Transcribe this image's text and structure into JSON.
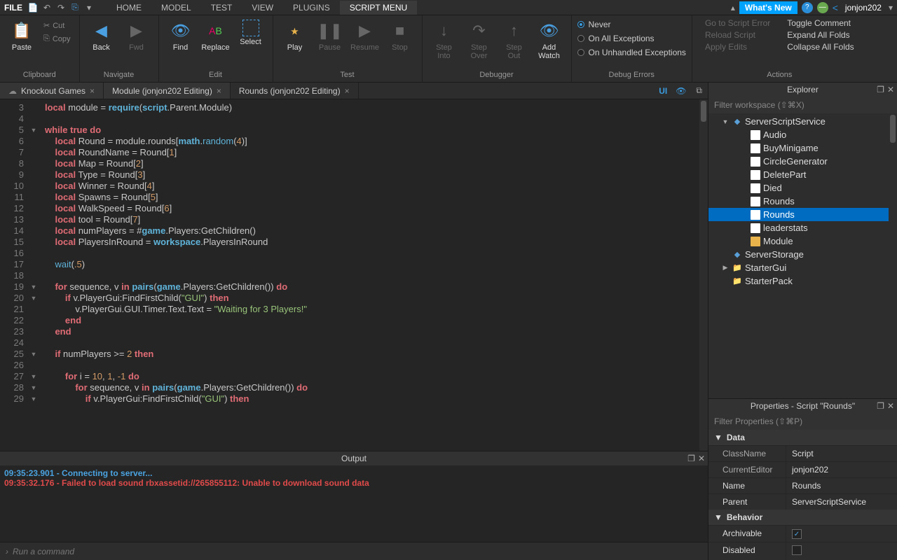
{
  "menu": {
    "file": "FILE",
    "tabs": [
      "HOME",
      "MODEL",
      "TEST",
      "VIEW",
      "PLUGINS",
      "SCRIPT MENU"
    ],
    "activeTab": 5,
    "whatsnew": "What's New",
    "username": "jonjon202"
  },
  "ribbon": {
    "clipboard": {
      "paste": "Paste",
      "cut": "Cut",
      "copy": "Copy",
      "label": "Clipboard"
    },
    "navigate": {
      "back": "Back",
      "fwd": "Fwd",
      "label": "Navigate"
    },
    "edit": {
      "find": "Find",
      "replace": "Replace",
      "select": "Select",
      "label": "Edit"
    },
    "test": {
      "play": "Play",
      "pause": "Pause",
      "resume": "Resume",
      "stop": "Stop",
      "label": "Test"
    },
    "debugger": {
      "stepinto": "Step\nInto",
      "stepover": "Step\nOver",
      "stepout": "Step\nOut",
      "addwatch": "Add\nWatch",
      "label": "Debugger"
    },
    "debugerrors": {
      "never": "Never",
      "onall": "On All Exceptions",
      "onunhand": "On Unhandled Exceptions",
      "label": "Debug Errors"
    },
    "actions1": {
      "goto": "Go to Script Error",
      "reload": "Reload Script",
      "apply": "Apply Edits"
    },
    "actions2": {
      "toggle": "Toggle Comment",
      "expand": "Expand All Folds",
      "collapse": "Collapse All Folds",
      "label": "Actions"
    }
  },
  "doctabs": {
    "items": [
      {
        "label": "Knockout Games",
        "hasCloud": true
      },
      {
        "label": "Module (jonjon202 Editing)"
      },
      {
        "label": "Rounds (jonjon202 Editing)"
      }
    ],
    "active": 2,
    "ui": "UI"
  },
  "code": {
    "startLine": 3,
    "lines": [
      [
        [
          "kw",
          "local"
        ],
        [
          "id",
          " module "
        ],
        [
          "op",
          "= "
        ],
        [
          "glob",
          "require"
        ],
        [
          "op",
          "("
        ],
        [
          "glob",
          "script"
        ],
        [
          "op",
          ".Parent.Module)"
        ]
      ],
      [],
      [
        [
          "kw",
          "while true do"
        ]
      ],
      [
        [
          "id",
          "    "
        ],
        [
          "kw",
          "local"
        ],
        [
          "id",
          " Round = module.rounds["
        ],
        [
          "glob",
          "math"
        ],
        [
          "op",
          "."
        ],
        [
          "fn",
          "random"
        ],
        [
          "op",
          "("
        ],
        [
          "num",
          "4"
        ],
        [
          "op",
          ")]"
        ]
      ],
      [
        [
          "id",
          "    "
        ],
        [
          "kw",
          "local"
        ],
        [
          "id",
          " RoundName = Round["
        ],
        [
          "num",
          "1"
        ],
        [
          "op",
          "]"
        ]
      ],
      [
        [
          "id",
          "    "
        ],
        [
          "kw",
          "local"
        ],
        [
          "id",
          " Map = Round["
        ],
        [
          "num",
          "2"
        ],
        [
          "op",
          "]"
        ]
      ],
      [
        [
          "id",
          "    "
        ],
        [
          "kw",
          "local"
        ],
        [
          "id",
          " Type = Round["
        ],
        [
          "num",
          "3"
        ],
        [
          "op",
          "]"
        ]
      ],
      [
        [
          "id",
          "    "
        ],
        [
          "kw",
          "local"
        ],
        [
          "id",
          " Winner = Round["
        ],
        [
          "num",
          "4"
        ],
        [
          "op",
          "]"
        ]
      ],
      [
        [
          "id",
          "    "
        ],
        [
          "kw",
          "local"
        ],
        [
          "id",
          " Spawns = Round["
        ],
        [
          "num",
          "5"
        ],
        [
          "op",
          "]"
        ]
      ],
      [
        [
          "id",
          "    "
        ],
        [
          "kw",
          "local"
        ],
        [
          "id",
          " WalkSpeed = Round["
        ],
        [
          "num",
          "6"
        ],
        [
          "op",
          "]"
        ]
      ],
      [
        [
          "id",
          "    "
        ],
        [
          "kw",
          "local"
        ],
        [
          "id",
          " tool = Round["
        ],
        [
          "num",
          "7"
        ],
        [
          "op",
          "]"
        ]
      ],
      [
        [
          "id",
          "    "
        ],
        [
          "kw",
          "local"
        ],
        [
          "id",
          " numPlayers = #"
        ],
        [
          "glob",
          "game"
        ],
        [
          "op",
          ".Players:GetChildren()"
        ]
      ],
      [
        [
          "id",
          "    "
        ],
        [
          "kw",
          "local"
        ],
        [
          "id",
          " PlayersInRound = "
        ],
        [
          "glob",
          "workspace"
        ],
        [
          "op",
          ".PlayersInRound"
        ]
      ],
      [],
      [
        [
          "id",
          "    "
        ],
        [
          "fn",
          "wait"
        ],
        [
          "op",
          "("
        ],
        [
          "num",
          ".5"
        ],
        [
          "op",
          ")"
        ]
      ],
      [],
      [
        [
          "id",
          "    "
        ],
        [
          "kw",
          "for"
        ],
        [
          "id",
          " sequence, v "
        ],
        [
          "kw",
          "in"
        ],
        [
          "id",
          " "
        ],
        [
          "glob",
          "pairs"
        ],
        [
          "op",
          "("
        ],
        [
          "glob",
          "game"
        ],
        [
          "op",
          ".Players:GetChildren()) "
        ],
        [
          "kw",
          "do"
        ]
      ],
      [
        [
          "id",
          "        "
        ],
        [
          "kw",
          "if"
        ],
        [
          "id",
          " v.PlayerGui:FindFirstChild("
        ],
        [
          "str",
          "\"GUI\""
        ],
        [
          "op",
          ") "
        ],
        [
          "kw",
          "then"
        ]
      ],
      [
        [
          "id",
          "            v.PlayerGui.GUI.Timer.Text.Text = "
        ],
        [
          "str",
          "\"Waiting for 3 Players!\""
        ]
      ],
      [
        [
          "id",
          "        "
        ],
        [
          "kw",
          "end"
        ]
      ],
      [
        [
          "id",
          "    "
        ],
        [
          "kw",
          "end"
        ]
      ],
      [],
      [
        [
          "id",
          "    "
        ],
        [
          "kw",
          "if"
        ],
        [
          "id",
          " numPlayers >= "
        ],
        [
          "num",
          "2"
        ],
        [
          "id",
          " "
        ],
        [
          "kw",
          "then"
        ]
      ],
      [],
      [
        [
          "id",
          "        "
        ],
        [
          "kw",
          "for"
        ],
        [
          "id",
          " i = "
        ],
        [
          "num",
          "10"
        ],
        [
          "op",
          ", "
        ],
        [
          "num",
          "1"
        ],
        [
          "op",
          ", "
        ],
        [
          "num",
          "-1"
        ],
        [
          "id",
          " "
        ],
        [
          "kw",
          "do"
        ]
      ],
      [
        [
          "id",
          "            "
        ],
        [
          "kw",
          "for"
        ],
        [
          "id",
          " sequence, v "
        ],
        [
          "kw",
          "in"
        ],
        [
          "id",
          " "
        ],
        [
          "glob",
          "pairs"
        ],
        [
          "op",
          "("
        ],
        [
          "glob",
          "game"
        ],
        [
          "op",
          ".Players:GetChildren()) "
        ],
        [
          "kw",
          "do"
        ]
      ],
      [
        [
          "id",
          "                "
        ],
        [
          "kw",
          "if"
        ],
        [
          "id",
          " v.PlayerGui:FindFirstChild("
        ],
        [
          "str",
          "\"GUI\""
        ],
        [
          "op",
          ") "
        ],
        [
          "kw",
          "then"
        ]
      ]
    ],
    "foldMarks": {
      "5": "▼",
      "19": "▼",
      "20": "▼",
      "25": "▼",
      "27": "▼",
      "28": "▼",
      "29": "▼"
    }
  },
  "output": {
    "title": "Output",
    "lines": [
      {
        "cls": "l1",
        "text": "09:35:23.901 - Connecting to server..."
      },
      {
        "cls": "l2",
        "text": "09:35:32.176 - Failed to load sound rbxassetid://265855112: Unable to download sound data"
      }
    ]
  },
  "cmd": {
    "placeholder": "Run a command"
  },
  "explorer": {
    "title": "Explorer",
    "filter": "Filter workspace (⇧⌘X)",
    "tree": [
      {
        "d": 1,
        "arr": "▼",
        "ico": "service",
        "label": "ServerScriptService"
      },
      {
        "d": 2,
        "ico": "script",
        "label": "Audio"
      },
      {
        "d": 2,
        "ico": "script",
        "label": "BuyMinigame"
      },
      {
        "d": 2,
        "ico": "script",
        "label": "CircleGenerator"
      },
      {
        "d": 2,
        "ico": "script",
        "label": "DeletePart"
      },
      {
        "d": 2,
        "ico": "script",
        "label": "Died"
      },
      {
        "d": 2,
        "ico": "script",
        "label": "Rounds"
      },
      {
        "d": 2,
        "ico": "script",
        "label": "Rounds",
        "sel": true
      },
      {
        "d": 2,
        "ico": "script",
        "label": "leaderstats"
      },
      {
        "d": 2,
        "ico": "module",
        "label": "Module"
      },
      {
        "d": 1,
        "arr": "",
        "ico": "service",
        "label": "ServerStorage"
      },
      {
        "d": 1,
        "arr": "▶",
        "ico": "folder",
        "label": "StarterGui"
      },
      {
        "d": 1,
        "arr": "",
        "ico": "folder",
        "label": "StarterPack"
      }
    ]
  },
  "properties": {
    "title": "Properties - Script \"Rounds\"",
    "filter": "Filter Properties (⇧⌘P)",
    "cats": [
      {
        "name": "Data",
        "rows": [
          {
            "k": "ClassName",
            "v": "Script",
            "ro": true
          },
          {
            "k": "CurrentEditor",
            "v": "jonjon202",
            "ro": true
          },
          {
            "k": "Name",
            "v": "Rounds"
          },
          {
            "k": "Parent",
            "v": "ServerScriptService"
          }
        ]
      },
      {
        "name": "Behavior",
        "rows": [
          {
            "k": "Archivable",
            "v": "check:true"
          },
          {
            "k": "Disabled",
            "v": "check:false"
          }
        ]
      }
    ]
  }
}
